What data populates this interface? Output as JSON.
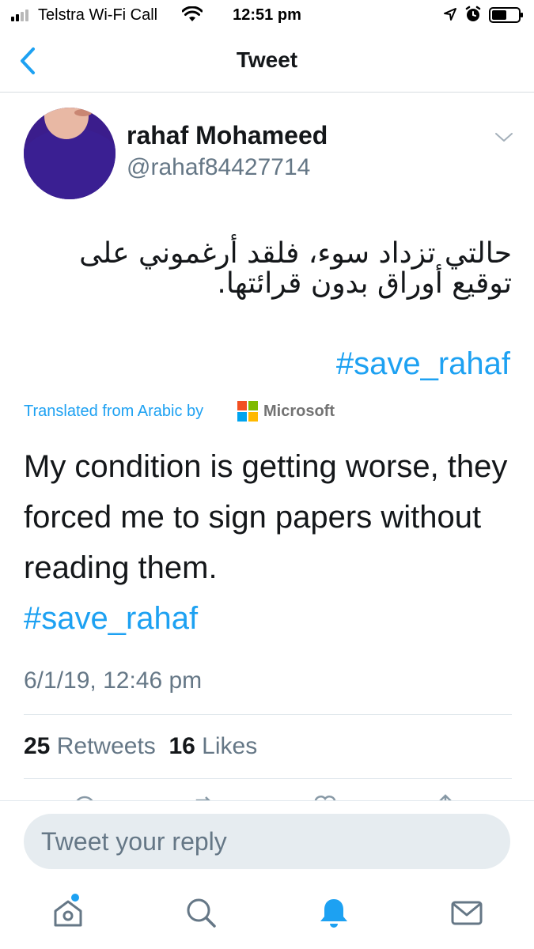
{
  "status_bar": {
    "carrier": "Telstra Wi-Fi Call",
    "time": "12:51 pm",
    "icons": [
      "signal-icon",
      "wifi-icon",
      "location-icon",
      "alarm-icon",
      "battery-icon"
    ]
  },
  "nav": {
    "title": "Tweet",
    "back_icon": "chevron-left-icon"
  },
  "tweet": {
    "author_name": "rahaf Mohameed",
    "author_handle": "@rahaf84427714",
    "menu_icon": "chevron-down-icon",
    "text_arabic": "حالتي تزداد سوء، فلقد أرغموني على توقيع أوراق بدون قرائتها.",
    "hashtag_arabic": "#save_rahaf",
    "translated_label": "Translated from Arabic by",
    "translator": "Microsoft",
    "translation": "My condition is getting worse, they forced me to sign papers without reading them.",
    "hashtag_translation": "#save_rahaf",
    "timestamp": "6/1/19, 12:46 pm",
    "retweets_count": "25",
    "retweets_label": "Retweets",
    "likes_count": "16",
    "likes_label": "Likes"
  },
  "reply": {
    "placeholder": "Tweet your reply"
  },
  "tabbar": {
    "items": [
      {
        "name": "home",
        "icon": "home-icon",
        "active": false,
        "has_dot": true
      },
      {
        "name": "search",
        "icon": "search-icon",
        "active": false
      },
      {
        "name": "notifications",
        "icon": "bell-icon",
        "active": true
      },
      {
        "name": "messages",
        "icon": "mail-icon",
        "active": false
      }
    ]
  },
  "colors": {
    "accent": "#1da1f2",
    "text": "#14171a",
    "secondary": "#657786",
    "avatar": "#3a1f92"
  }
}
